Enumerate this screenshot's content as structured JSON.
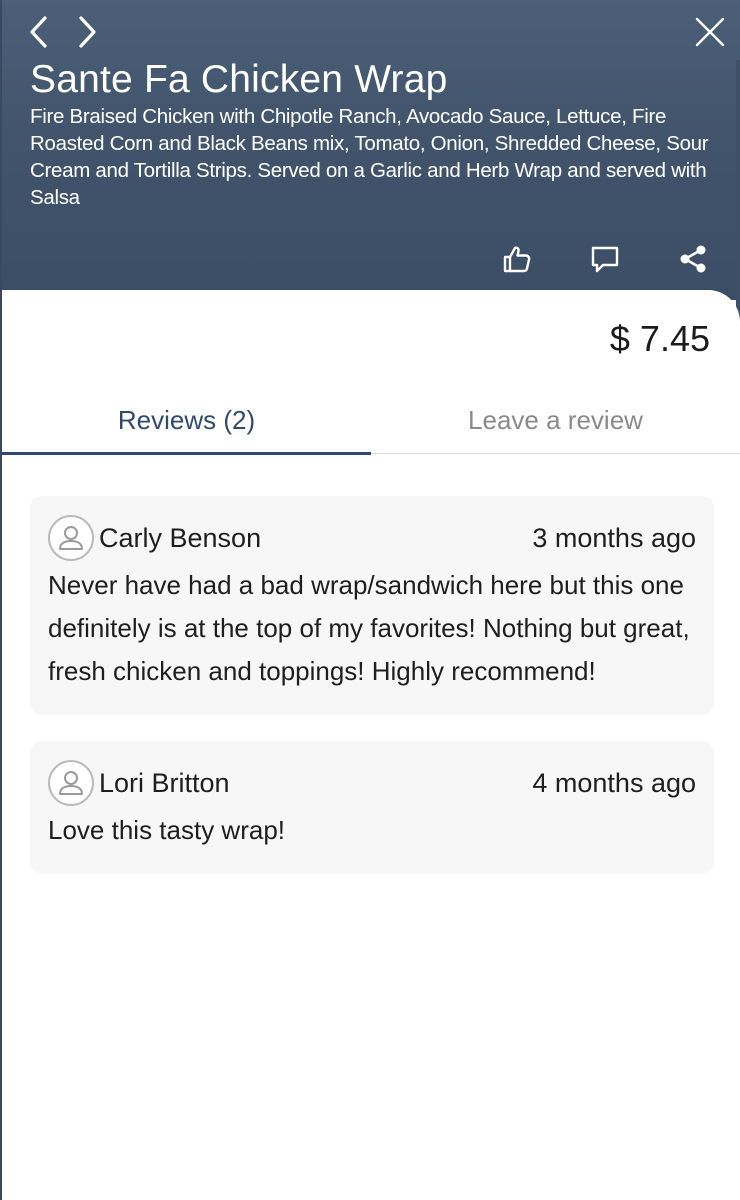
{
  "item": {
    "title": "Sante Fa Chicken Wrap",
    "description": "Fire Braised Chicken with Chipotle Ranch, Avocado Sauce, Lettuce, Fire Roasted Corn and Black Beans mix, Tomato, Onion, Shredded Cheese, Sour Cream and Tortilla Strips. Served on a Garlic and Herb Wrap and served with Salsa",
    "price": "$ 7.45"
  },
  "icons": {
    "back": "chevron-left-icon",
    "forward": "chevron-right-icon",
    "close": "close-icon",
    "like": "thumbs-up-icon",
    "comment": "comment-icon",
    "share": "share-icon",
    "avatar": "user-icon"
  },
  "tabs": [
    {
      "label": "Reviews (2)",
      "active": true
    },
    {
      "label": "Leave a review",
      "active": false
    }
  ],
  "reviews": [
    {
      "name": "Carly Benson",
      "time": "3 months ago",
      "text": "Never have had a bad wrap/sandwich here but this one definitely is at the top of my favorites! Nothing but great, fresh chicken and toppings! Highly recommend!"
    },
    {
      "name": "Lori Britton",
      "time": "4 months ago",
      "text": "Love this tasty wrap!"
    }
  ],
  "colors": {
    "header": "#44576f",
    "accent": "#2f4a6e",
    "inactive_tab": "#8a8a8a",
    "review_bg": "#f7f7f7"
  }
}
